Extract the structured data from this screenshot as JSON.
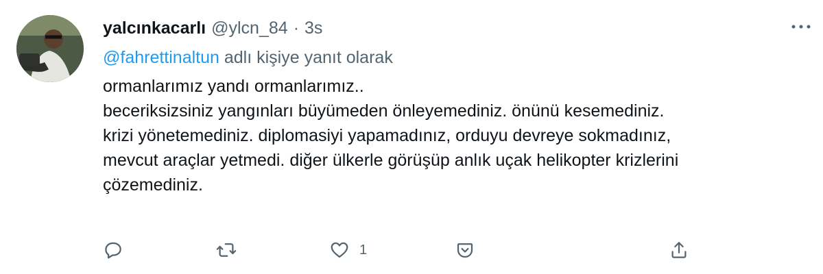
{
  "tweet": {
    "display_name": "yalcınkacarlı",
    "handle": "@ylcn_84",
    "separator": "·",
    "time": "3s",
    "reply_mention": "@fahrettinaltun",
    "reply_suffix": " adlı kişiye yanıt olarak",
    "body_lines": [
      "ormanlarımız yandı ormanlarımız..",
      "beceriksizsiniz yangınları büyümeden önleyemediniz. önünü kesemediniz.",
      "krizi yönetemediniz. diplomasiyi yapamadınız, orduyu devreye sokmadınız,",
      "mevcut araçlar yetmedi. diğer ülkerle görüşüp anlık uçak helikopter krizlerini",
      "çözemediniz."
    ]
  },
  "actions": {
    "reply_icon": "comment-icon",
    "retweet_icon": "retweet-icon",
    "like_icon": "heart-icon",
    "like_count": "1",
    "react_icon": "downvote-icon",
    "share_icon": "share-icon"
  },
  "colors": {
    "text_primary": "#0f1419",
    "text_secondary": "#536471",
    "link": "#1d9bf0",
    "background": "#ffffff"
  }
}
